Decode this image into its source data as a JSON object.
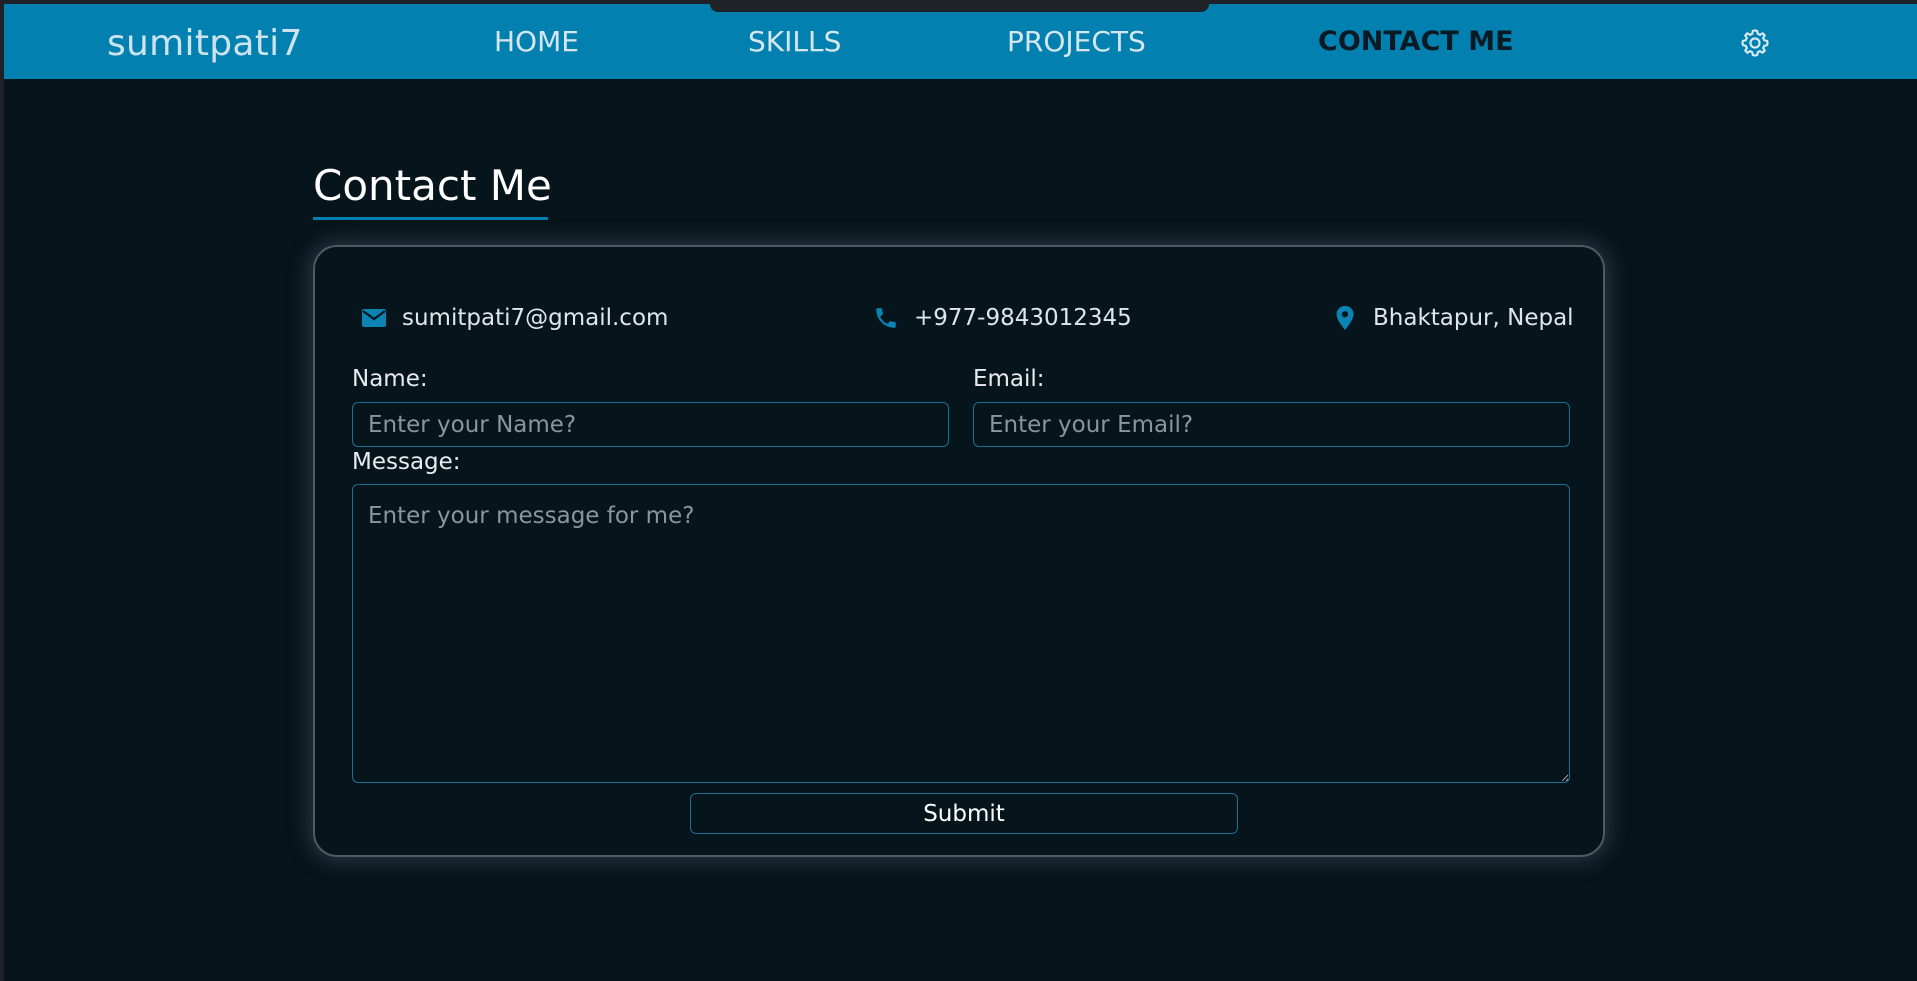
{
  "navbar": {
    "brand": "sumitpati7",
    "links": [
      {
        "label": "HOME",
        "active": false
      },
      {
        "label": "SKILLS",
        "active": false
      },
      {
        "label": "PROJECTS",
        "active": false
      },
      {
        "label": "CONTACT ME",
        "active": true
      }
    ],
    "settings_icon": "gear-icon"
  },
  "page": {
    "title": "Contact Me"
  },
  "contact_info": {
    "email": {
      "icon": "envelope-icon",
      "text": "sumitpati7@gmail.com"
    },
    "phone": {
      "icon": "phone-icon",
      "text": "+977-9843012345"
    },
    "location": {
      "icon": "map-pin-icon",
      "text": "Bhaktapur, Nepal"
    }
  },
  "form": {
    "name_label": "Name:",
    "name_placeholder": "Enter your Name?",
    "email_label": "Email:",
    "email_placeholder": "Enter your Email?",
    "message_label": "Message:",
    "message_placeholder": "Enter your message for me?",
    "submit_label": "Submit"
  },
  "colors": {
    "accent": "#0281b0",
    "background": "#06141b",
    "active_nav_text": "#0a1a24"
  }
}
